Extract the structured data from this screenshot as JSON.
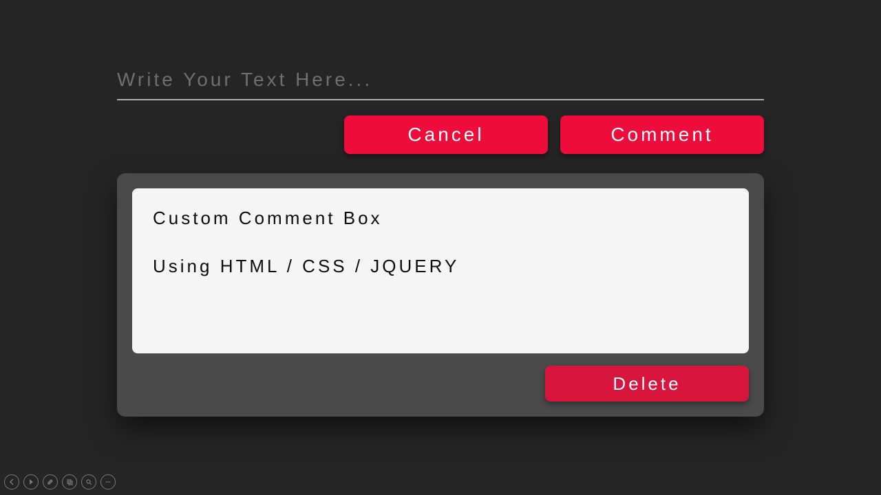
{
  "input": {
    "placeholder": "Write Your Text Here...",
    "value": ""
  },
  "buttons": {
    "cancel": "Cancel",
    "comment": "Comment",
    "delete": "Delete"
  },
  "comment_card": {
    "text": "Custom Comment Box\n\nUsing HTML / CSS / JQUERY"
  },
  "media_controls": [
    "prev",
    "play",
    "edit",
    "copy",
    "zoom",
    "more"
  ]
}
